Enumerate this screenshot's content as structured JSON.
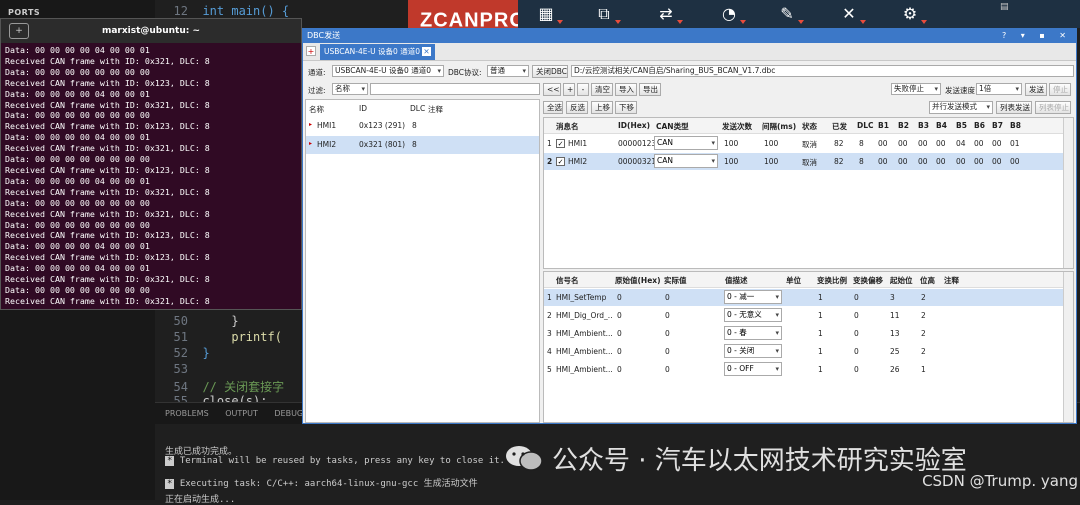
{
  "vscode": {
    "ports_label": "PORTS",
    "code": [
      {
        "ln": "12",
        "text": "int main() {"
      },
      {
        "ln": "50",
        "text": "}"
      },
      {
        "ln": "51",
        "text": "printf("
      },
      {
        "ln": "52",
        "text": "}"
      },
      {
        "ln": "53",
        "text": ""
      },
      {
        "ln": "54",
        "text": "// 关闭套接字"
      },
      {
        "ln": "55",
        "text": "close(s);"
      }
    ],
    "panel_tabs": [
      "PROBLEMS",
      "OUTPUT",
      "DEBUG CONSOLE"
    ],
    "task_lines": [
      "生成已成功完成。",
      "Terminal will be reused by tasks, press any key to close it.",
      "Executing task: C/C++: aarch64-linux-gnu-gcc 生成活动文件",
      "正在启动生成..."
    ]
  },
  "toolbar": {
    "logo": "ZCANPRO",
    "logo_tm": "TM",
    "icons": [
      "calculator-icon",
      "monitor-icon",
      "transfer-icon",
      "chart-icon",
      "edit-icon",
      "tools-icon",
      "gear-icon"
    ],
    "icon_glyphs": [
      "▦",
      "⧉",
      "⇄",
      "◔",
      "✎",
      "✕",
      "⚙"
    ]
  },
  "terminal": {
    "title": "marxist@ubuntu: ~",
    "tab_icon": "+",
    "lines": [
      "Data: 00 00 00 00 04 00 00 01",
      "Received CAN frame with ID: 0x321, DLC: 8",
      "Data: 00 00 00 00 00 00 00 00",
      "Received CAN frame with ID: 0x123, DLC: 8",
      "Data: 00 00 00 00 04 00 00 01",
      "Received CAN frame with ID: 0x321, DLC: 8",
      "Data: 00 00 00 00 00 00 00 00",
      "Received CAN frame with ID: 0x123, DLC: 8",
      "Data: 00 00 00 00 04 00 00 01",
      "Received CAN frame with ID: 0x321, DLC: 8",
      "Data: 00 00 00 00 00 00 00 00",
      "Received CAN frame with ID: 0x123, DLC: 8",
      "Data: 00 00 00 00 04 00 00 01",
      "Received CAN frame with ID: 0x321, DLC: 8",
      "Data: 00 00 00 00 00 00 00 00",
      "Received CAN frame with ID: 0x321, DLC: 8",
      "Data: 00 00 00 00 00 00 00 00",
      "Received CAN frame with ID: 0x123, DLC: 8",
      "Data: 00 00 00 00 04 00 00 01",
      "Received CAN frame with ID: 0x123, DLC: 8",
      "Data: 00 00 00 00 04 00 00 01",
      "Received CAN frame with ID: 0x321, DLC: 8",
      "Data: 00 00 00 00 00 00 00 00",
      "Received CAN frame with ID: 0x321, DLC: 8"
    ]
  },
  "dbc": {
    "window_title": "DBC发送",
    "window_controls": "? ▾ ▪ ✕",
    "tab_label": "USBCAN-4E-U 设备0 通道0",
    "channel_label": "通道:",
    "channel_value": "USBCAN-4E-U 设备0 通道0",
    "protocol_label": "DBC协议:",
    "protocol_value": "普通",
    "close_dbc": "关闭DBC",
    "dbc_path": "D:/云控测试相关/CAN自启/Sharing_BUS_BCAN_V1.7.dbc",
    "filter_label": "过滤:",
    "filter_value": "名称",
    "fail_value": "失败停止",
    "speed_label": "发送速度",
    "speed_value": "1倍",
    "send_btn": "发送",
    "stop_btn": "停止",
    "nav_btns": [
      "<<",
      "+",
      "-",
      "清空",
      "导入",
      "导出"
    ],
    "left_headers": [
      "名称",
      "ID",
      "DLC",
      "注释"
    ],
    "left_rows": [
      {
        "name": "HMI1",
        "id": "0x123 (291)",
        "dlc": "8"
      },
      {
        "name": "HMI2",
        "id": "0x321 (801)",
        "dlc": "8"
      }
    ],
    "right_btns": [
      "全选",
      "反选",
      "上移",
      "下移"
    ],
    "mode_value": "并行发送模式",
    "list_send": "列表发送",
    "list_stop": "列表停止",
    "msg_headers": [
      "消息名",
      "ID(Hex)",
      "CAN类型",
      "发送次数",
      "间隔(ms)",
      "状态",
      "已发",
      "DLC",
      "B1",
      "B2",
      "B3",
      "B4",
      "B5",
      "B6",
      "B7",
      "B8"
    ],
    "msg_rows": [
      {
        "idx": "1",
        "name": "HMI1",
        "id": "00000123",
        "type": "CAN",
        "count": "100",
        "interval": "100",
        "status": "取消",
        "sent": "82",
        "dlc": "8",
        "bytes": [
          "00",
          "00",
          "00",
          "00",
          "04",
          "00",
          "00",
          "01"
        ]
      },
      {
        "idx": "2",
        "name": "HMI2",
        "id": "00000321",
        "type": "CAN",
        "count": "100",
        "interval": "100",
        "status": "取消",
        "sent": "82",
        "dlc": "8",
        "bytes": [
          "00",
          "00",
          "00",
          "00",
          "00",
          "00",
          "00",
          "00"
        ]
      }
    ],
    "sig_headers": [
      "信号名",
      "原始值(Hex)",
      "实际值",
      "值描述",
      "单位",
      "变换比例",
      "变换偏移",
      "起始位",
      "位高",
      "注释"
    ],
    "sig_rows": [
      {
        "idx": "1",
        "name": "HMI_SetTemp",
        "raw": "0",
        "actual": "0",
        "desc": "0 - 减一",
        "scale": "1",
        "offset": "0",
        "start": "3",
        "len": "2"
      },
      {
        "idx": "2",
        "name": "HMI_Dig_Ord_...",
        "raw": "0",
        "actual": "0",
        "desc": "0 - 无意义",
        "scale": "1",
        "offset": "0",
        "start": "11",
        "len": "2"
      },
      {
        "idx": "3",
        "name": "HMI_Ambient...",
        "raw": "0",
        "actual": "0",
        "desc": "0 - 春",
        "scale": "1",
        "offset": "0",
        "start": "13",
        "len": "2"
      },
      {
        "idx": "4",
        "name": "HMI_Ambient...",
        "raw": "0",
        "actual": "0",
        "desc": "0 - 关闭",
        "scale": "1",
        "offset": "0",
        "start": "25",
        "len": "2"
      },
      {
        "idx": "5",
        "name": "HMI_Ambient...",
        "raw": "0",
        "actual": "0",
        "desc": "0 - OFF",
        "scale": "1",
        "offset": "0",
        "start": "26",
        "len": "1"
      }
    ]
  },
  "watermark": {
    "wechat": "公众号 · 汽车以太网技术研究实验室",
    "csdn": "CSDN @Trump. yang"
  },
  "colors": {
    "accent": "#3c78c8",
    "terminal_bg": "#300a24",
    "logo_red": "#c0392b"
  }
}
